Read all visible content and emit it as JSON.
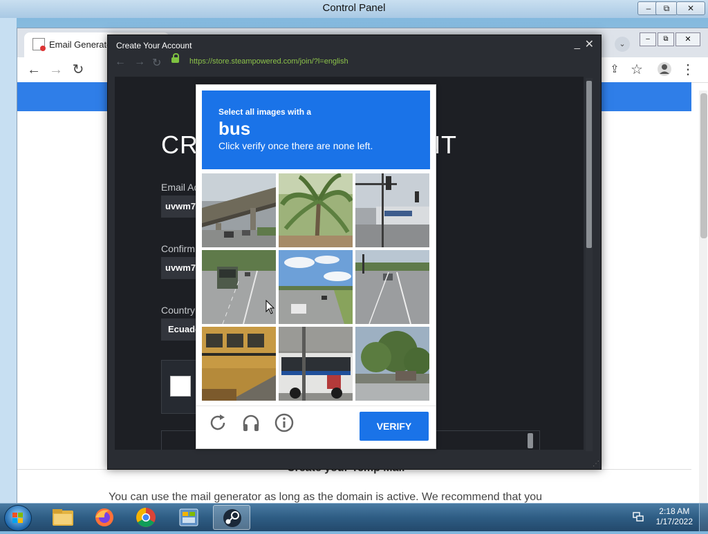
{
  "control_panel": {
    "title": "Control Panel",
    "minimize": "–",
    "restore": "⧉",
    "close": "✕"
  },
  "chrome": {
    "tab_label": "Email Generator",
    "page_heading": "Create your Temp Mail",
    "page_text": "You can use the mail generator as long as the domain is active. We recommend that you"
  },
  "steam_window": {
    "title": "Create Your Account",
    "url": "https://store.steampowered.com/join/?l=english",
    "heading_left": "CRE",
    "heading_right": "NT",
    "email_label": "Email Ad",
    "email_value": "uvwm7",
    "confirm_label": "Confirm",
    "confirm_value": "uvwm7",
    "country_label": "Country",
    "country_value": "Ecuado"
  },
  "captcha": {
    "instruction_line1": "Select all images with a",
    "target_word": "bus",
    "instruction_line2": "Click verify once there are none left.",
    "verify_label": "VERIFY",
    "tiles": [
      {
        "name": "tile-overpass-traffic"
      },
      {
        "name": "tile-palm-tree"
      },
      {
        "name": "tile-traffic-light-store"
      },
      {
        "name": "tile-road-bus-rear"
      },
      {
        "name": "tile-highway-sky"
      },
      {
        "name": "tile-road-cars"
      },
      {
        "name": "tile-school-bus"
      },
      {
        "name": "tile-city-bus"
      },
      {
        "name": "tile-tree-house"
      }
    ]
  },
  "taskbar": {
    "time": "2:18 AM",
    "date": "1/17/2022"
  }
}
